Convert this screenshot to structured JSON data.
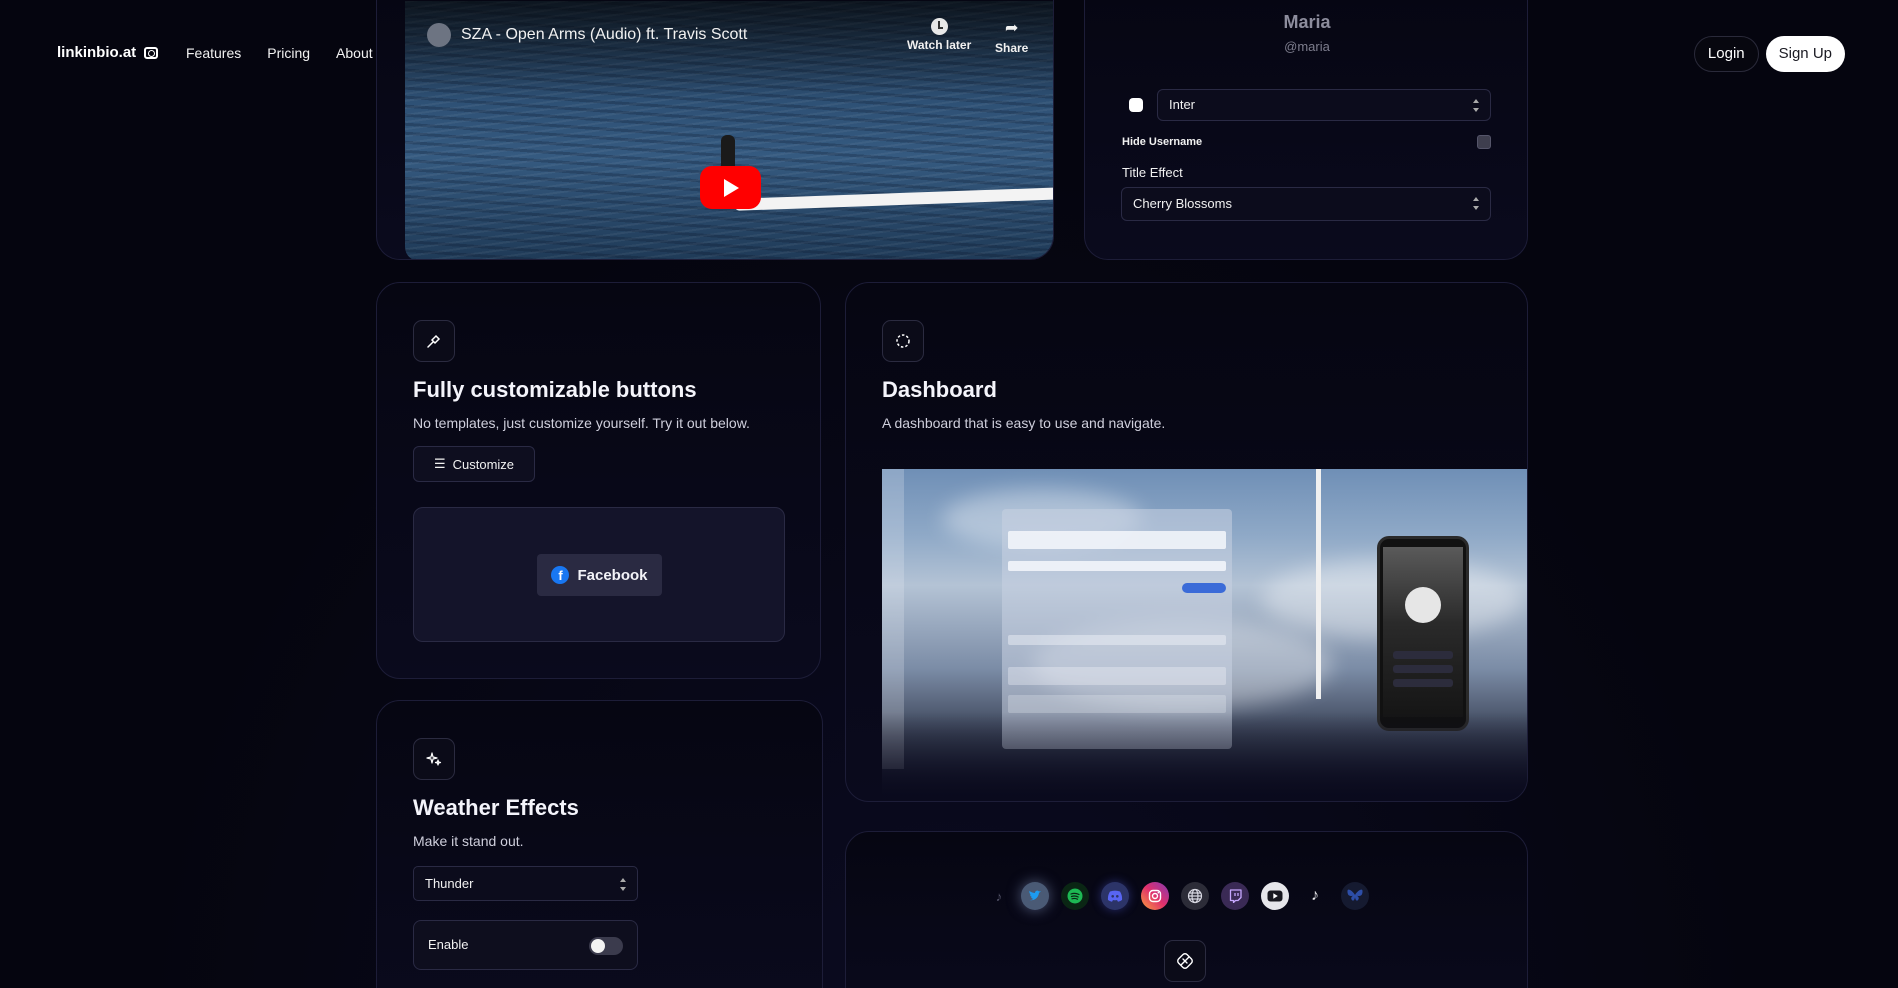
{
  "nav": {
    "brand": "linkinbio.at",
    "links": [
      "Features",
      "Pricing",
      "About"
    ],
    "login": "Login",
    "signup": "Sign Up"
  },
  "video": {
    "title": "SZA - Open Arms (Audio) ft. Travis Scott",
    "watch_later": "Watch later",
    "share": "Share"
  },
  "profile": {
    "name": "Maria",
    "username": "@maria",
    "font": "Inter",
    "hide_username_label": "Hide Username",
    "title_effect_label": "Title Effect",
    "title_effect_value": "Cherry Blossoms"
  },
  "buttons_card": {
    "title": "Fully customizable buttons",
    "desc": "No templates, just customize yourself. Try it out below.",
    "customize": "Customize",
    "preview_button": "Facebook"
  },
  "dashboard_card": {
    "title": "Dashboard",
    "desc": "A dashboard that is easy to use and navigate."
  },
  "weather_card": {
    "title": "Weather Effects",
    "desc": "Make it stand out.",
    "select_value": "Thunder",
    "enable_label": "Enable",
    "enabled": false
  },
  "socials_card": {
    "icons": [
      "tiktok-icon",
      "twitter-icon",
      "spotify-icon",
      "discord-icon",
      "instagram-icon",
      "globe-icon",
      "twitch-icon",
      "youtube-icon",
      "tiktok-icon",
      "bluesky-icon"
    ],
    "colors": {
      "twitter": "#1d9bf0",
      "spotify": "#1db954",
      "discord": "#5865f2",
      "instagram": "#e1306c",
      "twitch": "#9146ff",
      "youtube": "#ff0000"
    }
  }
}
